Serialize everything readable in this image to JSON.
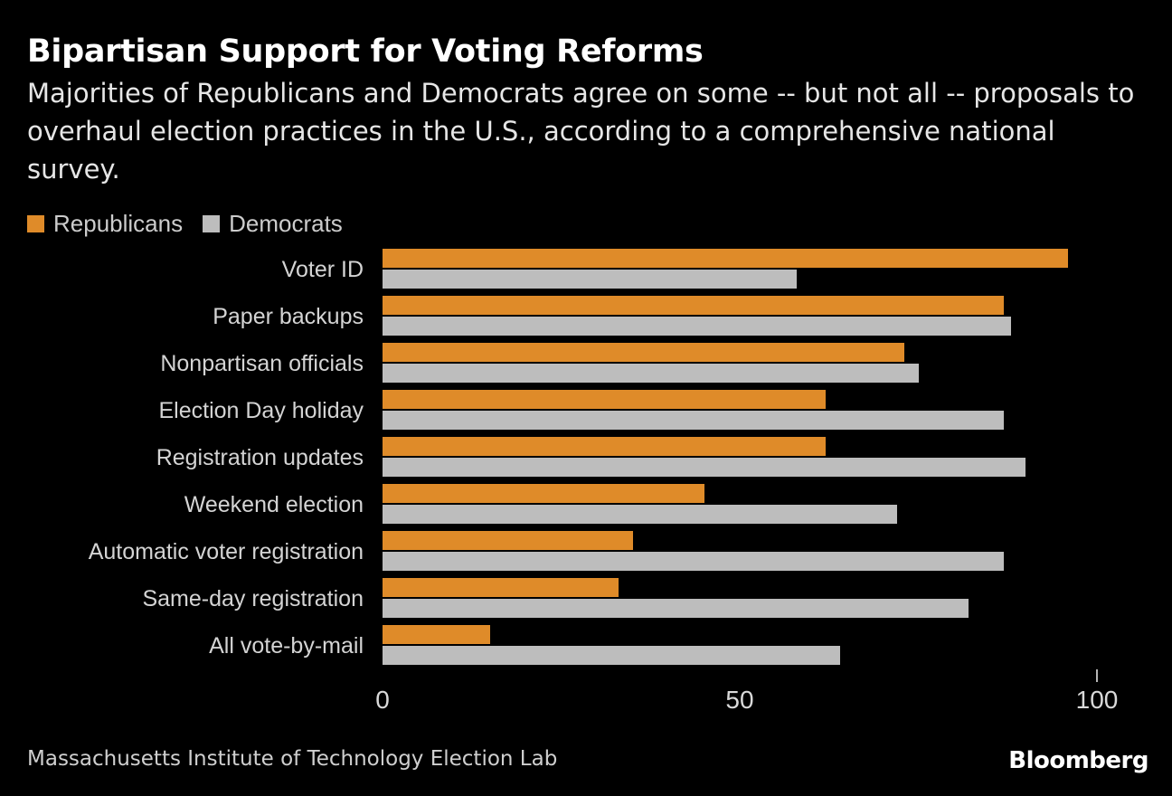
{
  "header": {
    "title": "Bipartisan Support for Voting Reforms",
    "subtitle": "Majorities of Republicans and Democrats agree on some -- but not all -- proposals to overhaul election practices in the U.S., according to a comprehensive national survey."
  },
  "footer": {
    "source": "Massachusetts Institute of Technology Election Lab",
    "brand": "Bloomberg"
  },
  "colors": {
    "republican": "#df8b29",
    "democrat": "#bdbdbd",
    "background": "#000000",
    "text": "#d9d9d9"
  },
  "chart_data": {
    "type": "bar",
    "orientation": "horizontal",
    "title": "Bipartisan Support for Voting Reforms",
    "subtitle": "Majorities of Republicans and Democrats agree on some -- but not all -- proposals to overhaul election practices in the U.S., according to a comprehensive national survey.",
    "xlabel": "",
    "ylabel": "",
    "xlim": [
      0,
      100
    ],
    "xticks": [
      0,
      50,
      100
    ],
    "xtick_labels": [
      "0",
      "50",
      "100"
    ],
    "grid": false,
    "legend_position": "top-left",
    "categories": [
      "Voter ID",
      "Paper backups",
      "Nonpartisan officials",
      "Election Day holiday",
      "Registration updates",
      "Weekend election",
      "Automatic voter registration",
      "Same-day registration",
      "All vote-by-mail"
    ],
    "series": [
      {
        "name": "Republicans",
        "color": "#df8b29",
        "values": [
          96,
          87,
          73,
          62,
          62,
          45,
          35,
          33,
          15
        ]
      },
      {
        "name": "Democrats",
        "color": "#bdbdbd",
        "values": [
          58,
          88,
          75,
          87,
          90,
          72,
          87,
          82,
          64
        ]
      }
    ]
  }
}
